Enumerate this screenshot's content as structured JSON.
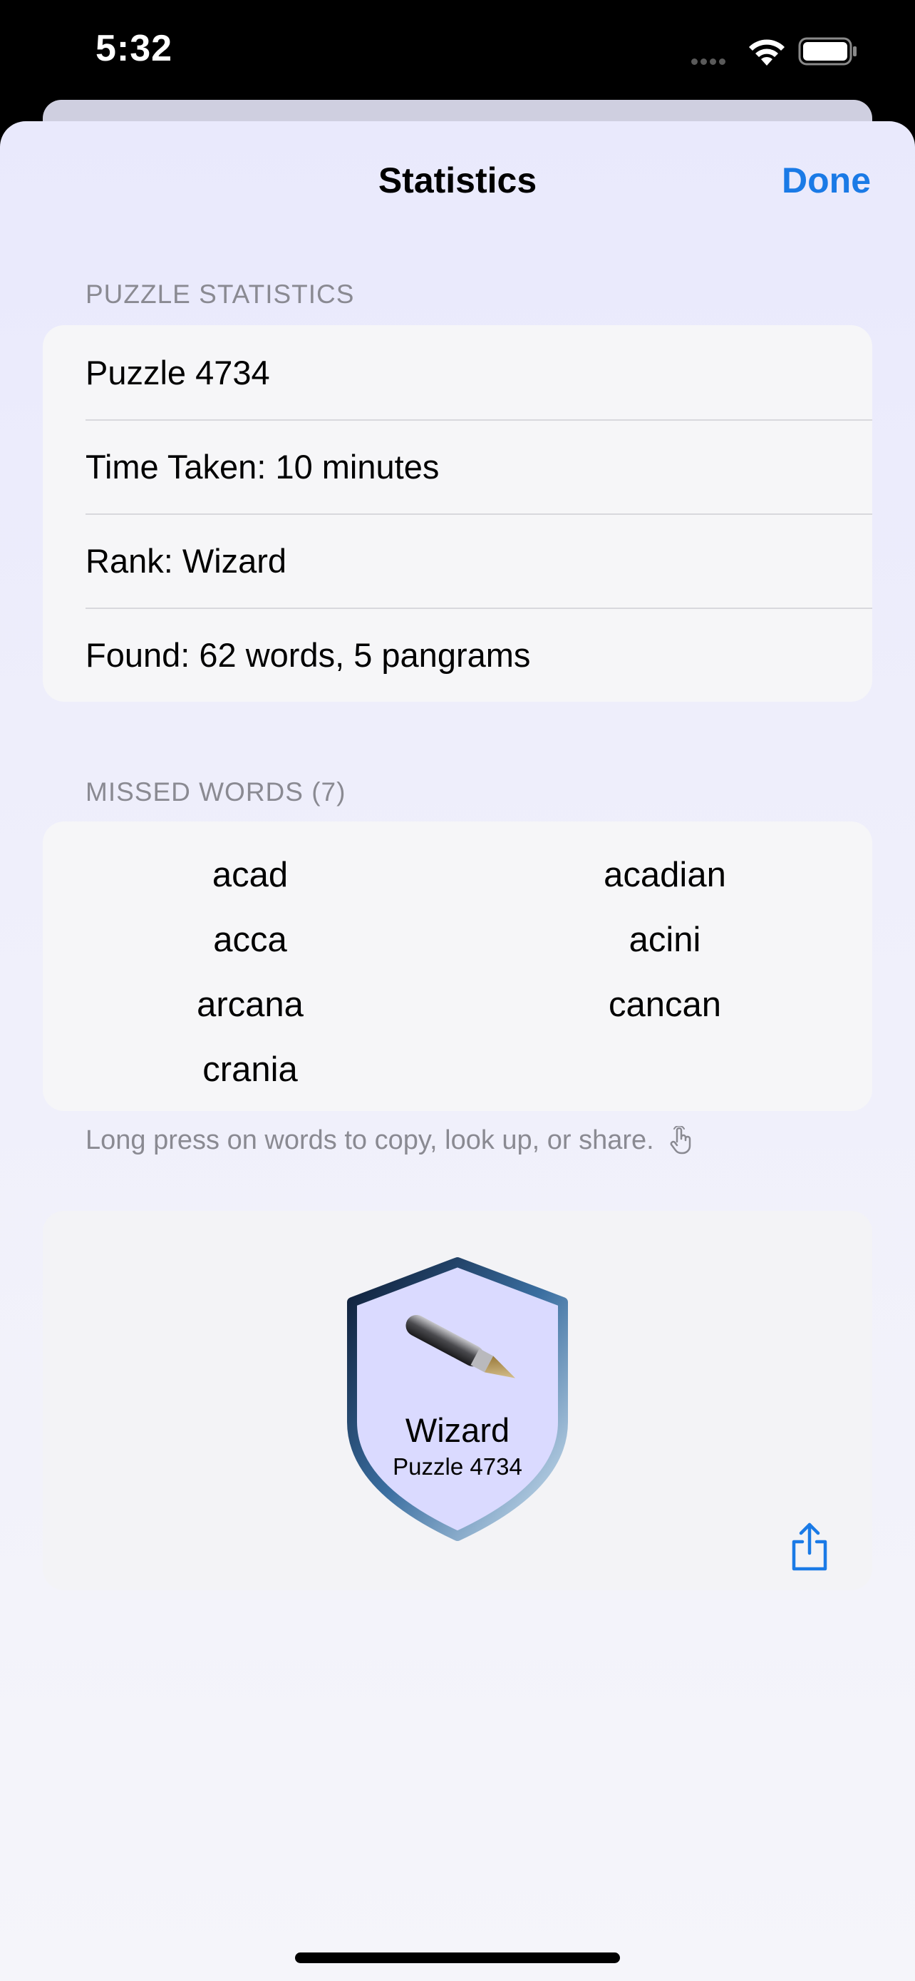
{
  "status_bar": {
    "time": "5:32"
  },
  "nav": {
    "title": "Statistics",
    "done_label": "Done"
  },
  "puzzle_statistics": {
    "header": "PUZZLE STATISTICS",
    "rows": [
      "Puzzle 4734",
      "Time Taken: 10 minutes",
      "Rank: Wizard",
      "Found: 62 words, 5 pangrams"
    ]
  },
  "missed_words": {
    "header": "MISSED WORDS (7)",
    "words": [
      "acad",
      "acadian",
      "acca",
      "acini",
      "arcana",
      "cancan",
      "crania"
    ],
    "footnote": "Long press on words to copy, look up, or share."
  },
  "badge": {
    "rank": "Wizard",
    "puzzle": "Puzzle 4734",
    "icon": "fountain-pen-icon"
  },
  "colors": {
    "accent": "#1a7ae6",
    "sheet_bg": "#efeffb",
    "badge_fill": "#dcdcff"
  }
}
